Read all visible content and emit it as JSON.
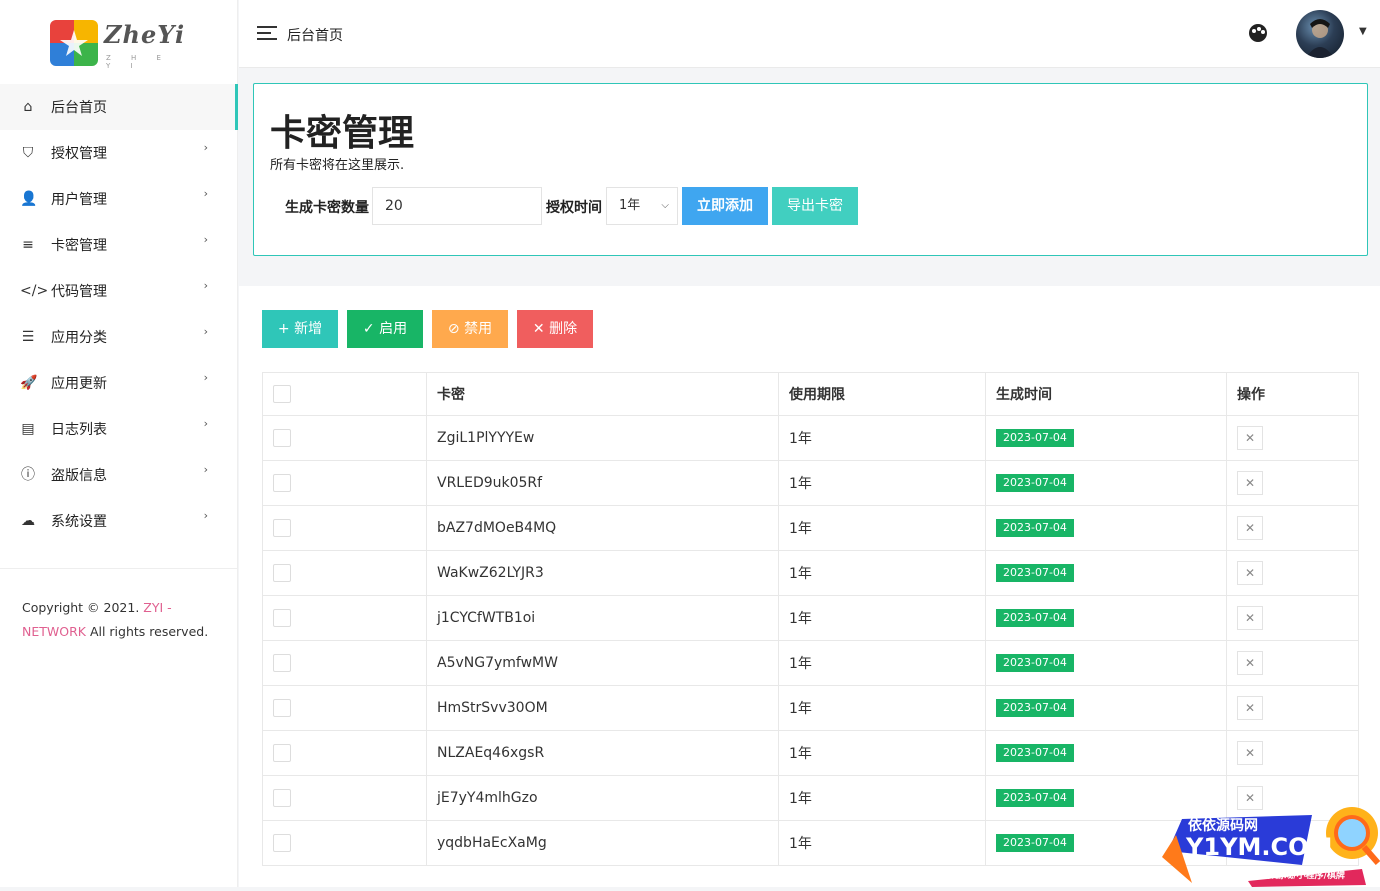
{
  "brand": {
    "name": "ZheYi",
    "sub": "Z H E Y I",
    "colors": {
      "red": "#e8423c",
      "yellow": "#f7b500",
      "green": "#3cb44a",
      "blue": "#2f7fd8"
    }
  },
  "topbar": {
    "breadcrumb": "后台首页",
    "menu_icon": "hamburger-icon",
    "theme_icon": "palette-icon",
    "avatar_caret": "caret-down-icon"
  },
  "sidebar": {
    "items": [
      {
        "label": "后台首页",
        "icon": "home-icon",
        "glyph": "⌂",
        "active": true,
        "has_children": false
      },
      {
        "label": "授权管理",
        "icon": "shield-icon",
        "glyph": "⛉",
        "active": false,
        "has_children": true
      },
      {
        "label": "用户管理",
        "icon": "user-icon",
        "glyph": "👤",
        "active": false,
        "has_children": true
      },
      {
        "label": "卡密管理",
        "icon": "list-icon",
        "glyph": "≡",
        "active": false,
        "has_children": true
      },
      {
        "label": "代码管理",
        "icon": "code-icon",
        "glyph": "</>",
        "active": false,
        "has_children": true
      },
      {
        "label": "应用分类",
        "icon": "category-icon",
        "glyph": "☰",
        "active": false,
        "has_children": true
      },
      {
        "label": "应用更新",
        "icon": "rocket-icon",
        "glyph": "🚀",
        "active": false,
        "has_children": true
      },
      {
        "label": "日志列表",
        "icon": "message-icon",
        "glyph": "▤",
        "active": false,
        "has_children": true
      },
      {
        "label": "盗版信息",
        "icon": "info-icon",
        "glyph": "ⓘ",
        "active": false,
        "has_children": true
      },
      {
        "label": "系统设置",
        "icon": "cloud-icon",
        "glyph": "☁",
        "active": false,
        "has_children": true
      }
    ],
    "arrow": "›",
    "copyright": {
      "prefix": "Copyright © 2021. ",
      "link": "ZYI - NETWORK",
      "suffix": " All rights reserved."
    }
  },
  "page": {
    "title": "卡密管理",
    "description": "所有卡密将在这里展示.",
    "form": {
      "count_label": "生成卡密数量",
      "count_value": "20",
      "duration_label": "授权时间",
      "duration_value": "1年",
      "add_label": "立即添加",
      "export_label": "导出卡密"
    },
    "colors": {
      "accent": "#2fc6b8",
      "blue": "#3fa6f0",
      "green": "#18b566",
      "orange": "#ffa94d",
      "red": "#f05e5e"
    }
  },
  "toolbar": {
    "add": {
      "icon": "plus-icon",
      "glyph": "+",
      "label": "新增"
    },
    "enable": {
      "icon": "check-icon",
      "glyph": "✓",
      "label": "启用"
    },
    "disable": {
      "icon": "ban-icon",
      "glyph": "⊘",
      "label": "禁用"
    },
    "delete": {
      "icon": "close-icon",
      "glyph": "✕",
      "label": "删除"
    }
  },
  "table": {
    "headers": [
      "卡密",
      "使用期限",
      "生成时间",
      "操作"
    ],
    "rows": [
      {
        "key": "ZgiL1PlYYYEw",
        "term": "1年",
        "date": "2023-07-04"
      },
      {
        "key": "VRLED9uk05Rf",
        "term": "1年",
        "date": "2023-07-04"
      },
      {
        "key": "bAZ7dMOeB4MQ",
        "term": "1年",
        "date": "2023-07-04"
      },
      {
        "key": "WaKwZ62LYJR3",
        "term": "1年",
        "date": "2023-07-04"
      },
      {
        "key": "j1CYCfWTB1oi",
        "term": "1年",
        "date": "2023-07-04"
      },
      {
        "key": "A5vNG7ymfwMW",
        "term": "1年",
        "date": "2023-07-04"
      },
      {
        "key": "HmStrSvv30OM",
        "term": "1年",
        "date": "2023-07-04"
      },
      {
        "key": "NLZAEq46xgsR",
        "term": "1年",
        "date": "2023-07-04"
      },
      {
        "key": "jE7yY4mlhGzo",
        "term": "1年",
        "date": "2023-07-04"
      },
      {
        "key": "yqdbHaEcXaMg",
        "term": "1年",
        "date": "2023-07-04"
      }
    ],
    "delete_glyph": "✕"
  },
  "watermark": {
    "line1": "依依源码网",
    "line2": "Y1YM.COM",
    "line3": "软件/游戏/小程序/棋牌"
  }
}
